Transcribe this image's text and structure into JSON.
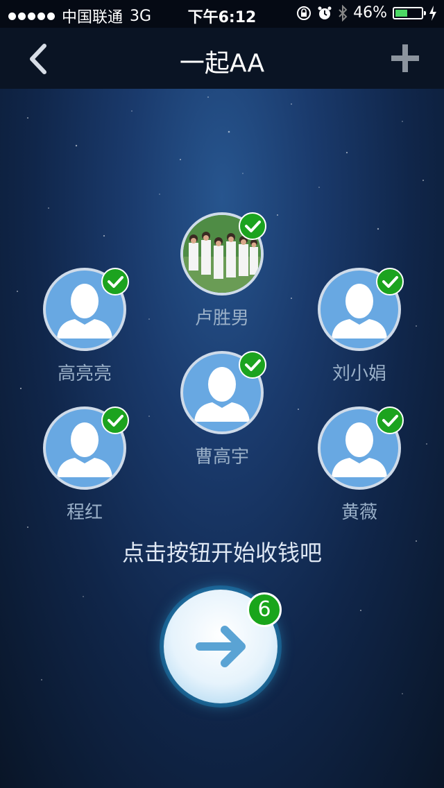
{
  "status_bar": {
    "carrier": "中国联通",
    "network": "3G",
    "time": "下午6:12",
    "battery": "46%",
    "battery_level": 0.46
  },
  "nav": {
    "title": "一起AA",
    "back_icon": "chevron-left-icon",
    "add_icon": "plus-icon"
  },
  "members": [
    {
      "name": "卢胜男",
      "has_photo": true,
      "confirmed": true
    },
    {
      "name": "高亮亮",
      "has_photo": false,
      "confirmed": true
    },
    {
      "name": "刘小娟",
      "has_photo": false,
      "confirmed": true
    },
    {
      "name": "曹高宇",
      "has_photo": false,
      "confirmed": true
    },
    {
      "name": "程红",
      "has_photo": false,
      "confirmed": true
    },
    {
      "name": "黄薇",
      "has_photo": false,
      "confirmed": true
    }
  ],
  "prompt": "点击按钮开始收钱吧",
  "start_button": {
    "icon": "arrow-right-icon",
    "badge_count": "6"
  },
  "colors": {
    "accent_green": "#1ca31f",
    "avatar_blue": "#68a8e2",
    "button_glow": "#3fb2e0"
  }
}
